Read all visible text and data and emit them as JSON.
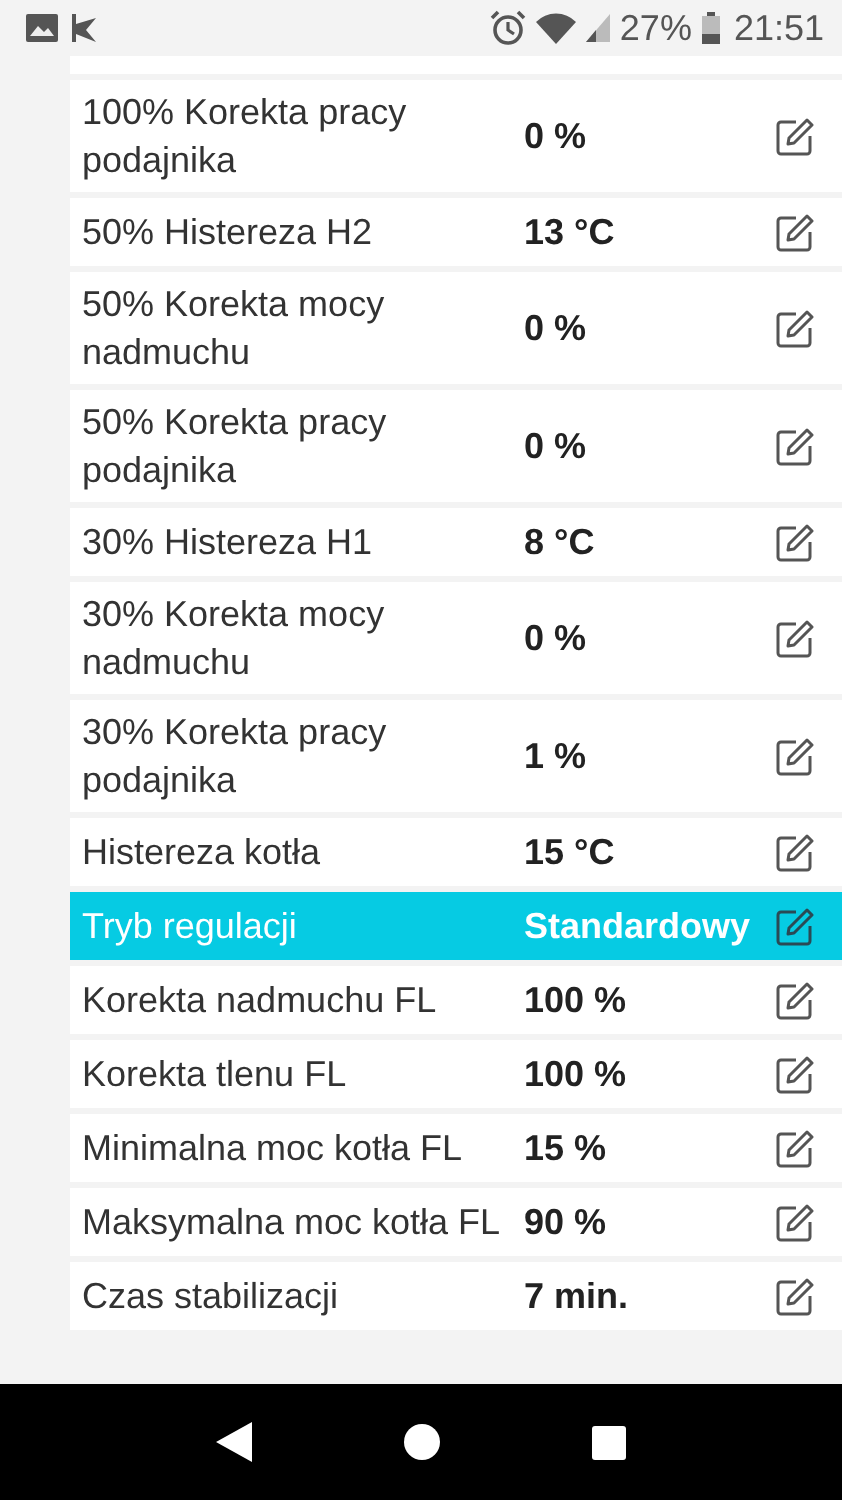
{
  "status_bar": {
    "battery": "27%",
    "time": "21:51"
  },
  "rows": [
    {
      "label": "100% Korekta pracy podajnika",
      "value": "0 %",
      "selected": false
    },
    {
      "label": "50% Histereza H2",
      "value": "13 °C",
      "selected": false
    },
    {
      "label": "50% Korekta mocy nadmuchu",
      "value": "0 %",
      "selected": false
    },
    {
      "label": "50% Korekta pracy podajnika",
      "value": "0 %",
      "selected": false
    },
    {
      "label": "30% Histereza H1",
      "value": "8 °C",
      "selected": false
    },
    {
      "label": "30% Korekta mocy nadmuchu",
      "value": "0 %",
      "selected": false
    },
    {
      "label": "30% Korekta pracy podajnika",
      "value": "1 %",
      "selected": false
    },
    {
      "label": "Histereza kotła",
      "value": "15 °C",
      "selected": false
    },
    {
      "label": "Tryb regulacji",
      "value": "Standardowy",
      "selected": true
    },
    {
      "label": "Korekta nadmuchu FL",
      "value": "100 %",
      "selected": false
    },
    {
      "label": "Korekta tlenu FL",
      "value": "100 %",
      "selected": false
    },
    {
      "label": "Minimalna moc kotła FL",
      "value": "15 %",
      "selected": false
    },
    {
      "label": "Maksymalna moc kotła FL",
      "value": "90 %",
      "selected": false
    },
    {
      "label": "Czas stabilizacji",
      "value": "7 min.",
      "selected": false
    }
  ]
}
